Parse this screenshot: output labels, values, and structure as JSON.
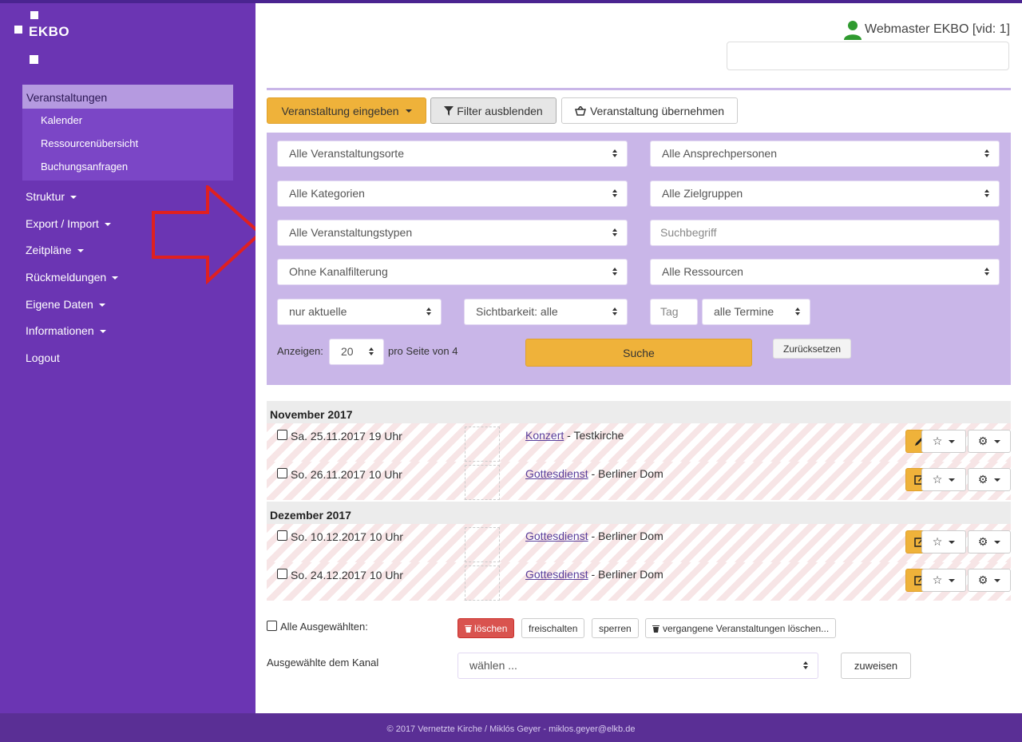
{
  "brand": {
    "logo_text": "EKBO"
  },
  "sidebar": {
    "active": "Veranstaltungen",
    "sub_items": [
      "Kalender",
      "Ressourcenübersicht",
      "Buchungsanfragen"
    ],
    "items": [
      "Struktur",
      "Export / Import",
      "Zeitpläne",
      "Rückmeldungen",
      "Eigene Daten",
      "Informationen",
      "Logout"
    ]
  },
  "header": {
    "user": "Webmaster EKBO [vid: 1]"
  },
  "toolbar": {
    "enter_event": "Veranstaltung eingeben",
    "hide_filter": "Filter ausblenden",
    "take_over": "Veranstaltung übernehmen"
  },
  "filters": {
    "locations": "Alle Veranstaltungsorte",
    "contacts": "Alle Ansprechpersonen",
    "categories": "Alle Kategorien",
    "target_groups": "Alle Zielgruppen",
    "event_types": "Alle Veranstaltungstypen",
    "search_placeholder": "Suchbegriff",
    "channel": "Ohne Kanalfilterung",
    "resources": "Alle Ressourcen",
    "current": "nur aktuelle",
    "visibility": "Sichtbarkeit: alle",
    "day_placeholder": "Tag",
    "dates": "alle Termine",
    "show_label": "Anzeigen:",
    "per_page": "20",
    "page_info": "pro Seite von 4",
    "search_button": "Suche",
    "reset_button": "Zurücksetzen"
  },
  "events": [
    {
      "month": "November 2017",
      "rows": [
        {
          "date": "Sa. 25.11.2017 19 Uhr",
          "title": "Konzert",
          "place": " - Testkirche"
        },
        {
          "date": "So. 26.11.2017 10 Uhr",
          "title": "Gottesdienst",
          "place": " - Berliner Dom"
        }
      ]
    },
    {
      "month": "Dezember 2017",
      "rows": [
        {
          "date": "So. 10.12.2017 10 Uhr",
          "title": "Gottesdienst",
          "place": " - Berliner Dom"
        },
        {
          "date": "So. 24.12.2017 10 Uhr",
          "title": "Gottesdienst",
          "place": " - Berliner Dom"
        }
      ]
    }
  ],
  "bulk": {
    "all_selected": "Alle Ausgewählten:",
    "delete": "löschen",
    "unlock": "freischalten",
    "lock": "sperren",
    "delete_past": "vergangene Veranstaltungen löschen...",
    "channel_label": "Ausgewählte dem Kanal",
    "choose": "wählen ...",
    "assign": "zuweisen"
  },
  "footer": {
    "text": "© 2017 Vernetzte Kirche / Miklós Geyer - miklos.geyer@elkb.de"
  },
  "colors": {
    "sidebar": "#6b35b3",
    "accent": "#efb23a",
    "filter_bg": "#c9b6e8",
    "danger": "#d9534f"
  }
}
